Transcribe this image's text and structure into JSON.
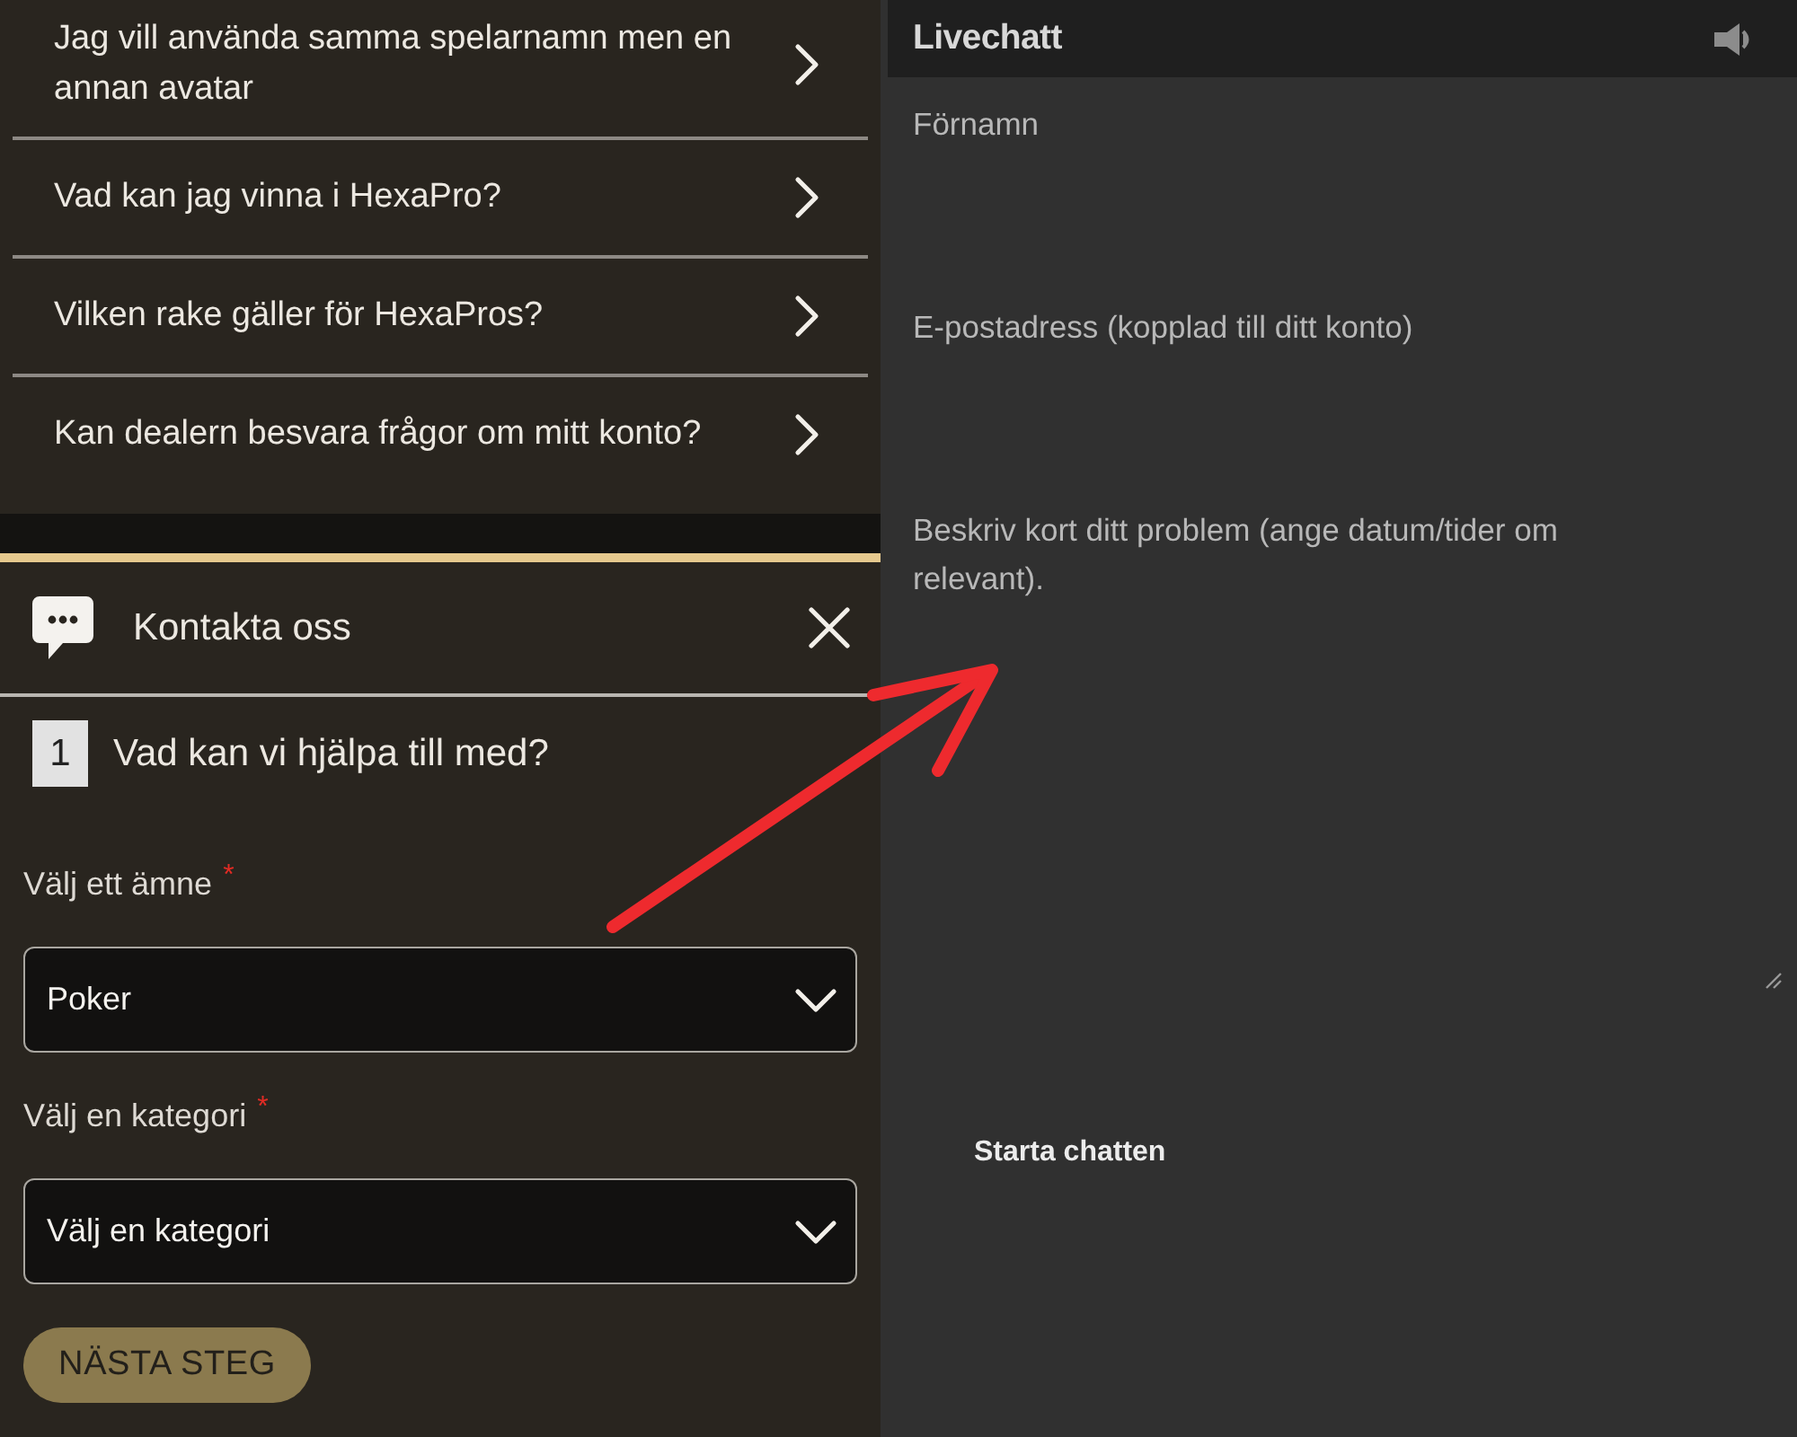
{
  "faq": {
    "items": [
      {
        "question": "Jag vill använda samma spelarnamn men en annan avatar"
      },
      {
        "question": "Vad kan jag vinna i HexaPro?"
      },
      {
        "question": "Vilken rake gäller för HexaPros?"
      },
      {
        "question": "Kan dealern besvara frågor om mitt konto?"
      }
    ]
  },
  "contact": {
    "title": "Kontakta oss",
    "step": {
      "number": "1",
      "title": "Vad kan vi hjälpa till med?"
    },
    "fields": [
      {
        "label": "Välj ett ämne",
        "required_mark": "*",
        "value": "Poker"
      },
      {
        "label": "Välj en kategori",
        "required_mark": "*",
        "value": "Välj en kategori"
      }
    ],
    "next_button": "NÄSTA STEG"
  },
  "livechat": {
    "title": "Livechatt",
    "fields": [
      {
        "label": "Förnamn",
        "kind": "input"
      },
      {
        "label": "E-postadress (kopplad till ditt konto)",
        "kind": "input"
      },
      {
        "label": "Beskriv kort ditt problem (ange datum/tider om relevant).",
        "kind": "textarea"
      }
    ],
    "start_button": "Starta chatten"
  }
}
